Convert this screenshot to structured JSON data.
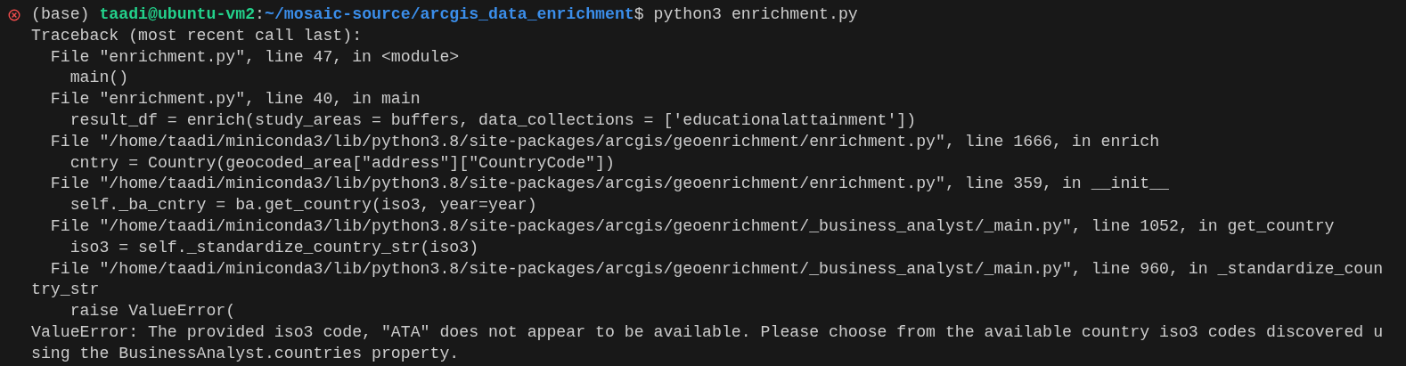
{
  "prompt": {
    "failed": true,
    "env": "(base)",
    "user_host": "taadi@ubuntu-vm2",
    "separator": ":",
    "path": "~/mosaic-source/arcgis_data_enrichment",
    "command": "$ python3 enrichment.py"
  },
  "output_lines": [
    "Traceback (most recent call last):",
    "  File \"enrichment.py\", line 47, in <module>",
    "    main()",
    "  File \"enrichment.py\", line 40, in main",
    "    result_df = enrich(study_areas = buffers, data_collections = ['educationalattainment'])",
    "  File \"/home/taadi/miniconda3/lib/python3.8/site-packages/arcgis/geoenrichment/enrichment.py\", line 1666, in enrich",
    "    cntry = Country(geocoded_area[\"address\"][\"CountryCode\"])",
    "  File \"/home/taadi/miniconda3/lib/python3.8/site-packages/arcgis/geoenrichment/enrichment.py\", line 359, in __init__",
    "    self._ba_cntry = ba.get_country(iso3, year=year)",
    "  File \"/home/taadi/miniconda3/lib/python3.8/site-packages/arcgis/geoenrichment/_business_analyst/_main.py\", line 1052, in get_country",
    "    iso3 = self._standardize_country_str(iso3)",
    "  File \"/home/taadi/miniconda3/lib/python3.8/site-packages/arcgis/geoenrichment/_business_analyst/_main.py\", line 960, in _standardize_coun",
    "try_str",
    "    raise ValueError(",
    "ValueError: The provided iso3 code, \"ATA\" does not appear to be available. Please choose from the available country iso3 codes discovered u",
    "sing the BusinessAnalyst.countries property."
  ]
}
